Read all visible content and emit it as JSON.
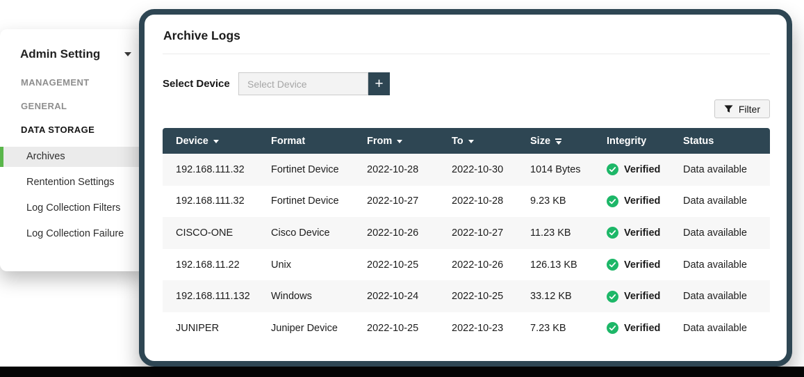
{
  "colors": {
    "header_slate": "#2e4653",
    "accent_green": "#5ab64b",
    "verified_green": "#1db768",
    "row_alt": "#f7f7f7"
  },
  "icons": {
    "add": "+"
  },
  "sidebar": {
    "title": "Admin Setting",
    "sections": [
      {
        "label": "MANAGEMENT"
      },
      {
        "label": "GENERAL"
      },
      {
        "label": "DATA STORAGE"
      }
    ],
    "items": [
      {
        "label": "Archives",
        "active": true
      },
      {
        "label": "Rentention Settings",
        "active": false
      },
      {
        "label": "Log Collection Filters",
        "active": false
      },
      {
        "label": "Log Collection Failure",
        "active": false
      }
    ]
  },
  "main": {
    "title": "Archive Logs",
    "select_device": {
      "label": "Select Device",
      "placeholder": "Select Device"
    },
    "filter_button": {
      "label": "Filter"
    },
    "table": {
      "columns": [
        {
          "label": "Device",
          "sortable": true
        },
        {
          "label": "Format",
          "sortable": false
        },
        {
          "label": "From",
          "sortable": true
        },
        {
          "label": "To",
          "sortable": true
        },
        {
          "label": "Size",
          "sortable": true
        },
        {
          "label": "Integrity",
          "sortable": false
        },
        {
          "label": "Status",
          "sortable": false
        }
      ],
      "rows": [
        {
          "device": "192.168.111.32",
          "format": "Fortinet Device",
          "from": "2022-10-28",
          "to": "2022-10-30",
          "size": "1014 Bytes",
          "integrity": "Verified",
          "status": "Data available"
        },
        {
          "device": "192.168.111.32",
          "format": "Fortinet Device",
          "from": "2022-10-27",
          "to": "2022-10-28",
          "size": "9.23 KB",
          "integrity": "Verified",
          "status": "Data available"
        },
        {
          "device": "CISCO-ONE",
          "format": "Cisco Device",
          "from": "2022-10-26",
          "to": "2022-10-27",
          "size": "11.23 KB",
          "integrity": "Verified",
          "status": "Data available"
        },
        {
          "device": "192.168.11.22",
          "format": "Unix",
          "from": "2022-10-25",
          "to": "2022-10-26",
          "size": "126.13 KB",
          "integrity": "Verified",
          "status": "Data available"
        },
        {
          "device": "192.168.111.132",
          "format": "Windows",
          "from": "2022-10-24",
          "to": "2022-10-25",
          "size": "33.12 KB",
          "integrity": "Verified",
          "status": "Data available"
        },
        {
          "device": "JUNIPER",
          "format": "Juniper Device",
          "from": "2022-10-25",
          "to": "2022-10-23",
          "size": "7.23 KB",
          "integrity": "Verified",
          "status": "Data available"
        }
      ]
    }
  }
}
